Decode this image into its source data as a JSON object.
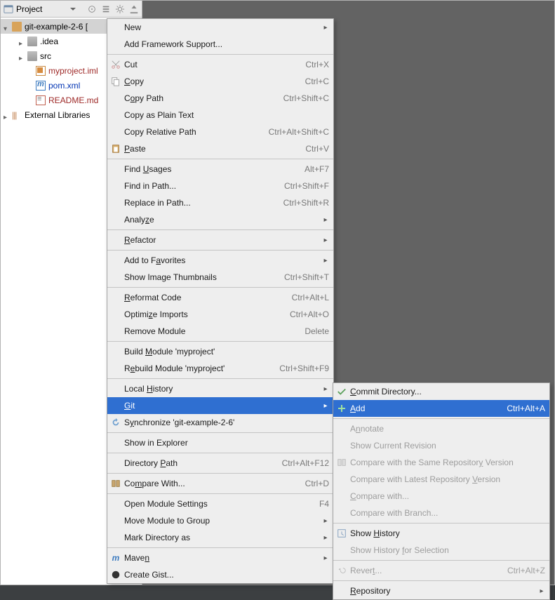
{
  "header": {
    "title": "Project"
  },
  "tree": {
    "root": "git-example-2-6 [",
    "idea": ".idea",
    "src": "src",
    "iml": "myproject.iml",
    "pom": "pom.xml",
    "readme": "README.md",
    "extlibs": "External Libraries"
  },
  "menu1": {
    "new": "New",
    "addfw": "Add Framework Support...",
    "cut": "Cut",
    "cut_sc": "Ctrl+X",
    "copy": "Copy",
    "copy_sc": "Ctrl+C",
    "copypath": "Copy Path",
    "copypath_sc": "Ctrl+Shift+C",
    "copyplain": "Copy as Plain Text",
    "copyrel": "Copy Relative Path",
    "copyrel_sc": "Ctrl+Alt+Shift+C",
    "paste": "Paste",
    "paste_sc": "Ctrl+V",
    "findu": "Find Usages",
    "findu_sc": "Alt+F7",
    "findp": "Find in Path...",
    "findp_sc": "Ctrl+Shift+F",
    "replp": "Replace in Path...",
    "replp_sc": "Ctrl+Shift+R",
    "analyze": "Analyze",
    "refactor": "Refactor",
    "addfav": "Add to Favorites",
    "thumbs": "Show Image Thumbnails",
    "thumbs_sc": "Ctrl+Shift+T",
    "reformat": "Reformat Code",
    "reformat_sc": "Ctrl+Alt+L",
    "optimp": "Optimize Imports",
    "optimp_sc": "Ctrl+Alt+O",
    "remmod": "Remove Module",
    "remmod_sc": "Delete",
    "buildm": "Build Module 'myproject'",
    "rebuildm": "Rebuild Module 'myproject'",
    "rebuildm_sc": "Ctrl+Shift+F9",
    "lochist": "Local History",
    "git": "Git",
    "sync": "Synchronize 'git-example-2-6'",
    "showexp": "Show in Explorer",
    "dirpath": "Directory Path",
    "dirpath_sc": "Ctrl+Alt+F12",
    "cmpwith": "Compare With...",
    "cmpwith_sc": "Ctrl+D",
    "openms": "Open Module Settings",
    "openms_sc": "F4",
    "movemod": "Move Module to Group",
    "markdir": "Mark Directory as",
    "maven": "Maven",
    "gist": "Create Gist..."
  },
  "menu2": {
    "commit": "Commit Directory...",
    "add": "Add",
    "add_sc": "Ctrl+Alt+A",
    "annotate": "Annotate",
    "showrev": "Show Current Revision",
    "cmpsame": "Compare with the Same Repository Version",
    "cmplatest": "Compare with Latest Repository Version",
    "cmpwith": "Compare with...",
    "cmpbranch": "Compare with Branch...",
    "showhist": "Show History",
    "showhistsel": "Show History for Selection",
    "revert": "Revert...",
    "revert_sc": "Ctrl+Alt+Z",
    "repo": "Repository"
  }
}
